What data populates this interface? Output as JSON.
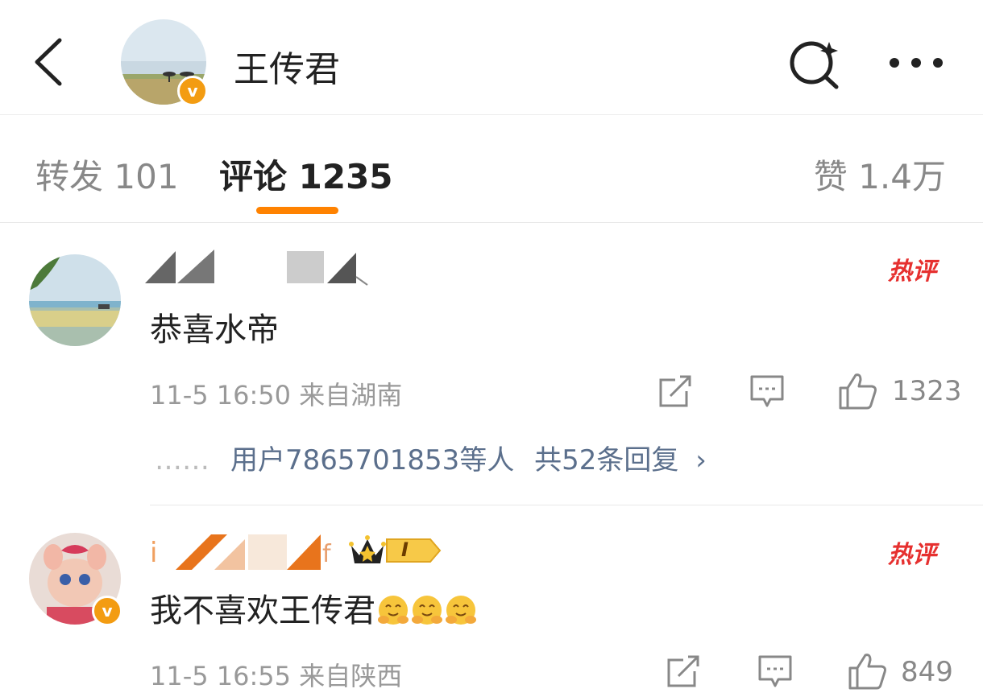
{
  "header": {
    "title": "王传君",
    "verified_badge": "v",
    "icons": [
      "back-arrow-icon",
      "search-icon",
      "more-icon"
    ]
  },
  "tabs": [
    {
      "label": "转发",
      "count": "101",
      "active": false
    },
    {
      "label": "评论",
      "count": "1235",
      "active": true
    },
    {
      "label": "赞",
      "count": "1.4万",
      "active": false
    }
  ],
  "accent_color": "#ff8200",
  "comments": [
    {
      "text": "恭喜水帝",
      "time": "11-5 16:50",
      "location": "来自湖南",
      "hot_label": "热评",
      "likes": "1323",
      "replies_dots": "……",
      "replies_users": "用户7865701853等人",
      "replies_count": "共52条回复",
      "replies_chevron": "›"
    },
    {
      "text": "我不喜欢王传君",
      "emojis": [
        "hug-emoji",
        "hug-emoji",
        "hug-emoji"
      ],
      "time": "11-5 16:55",
      "location": "来自陕西",
      "hot_label": "热评",
      "likes": "849",
      "verified_badge": "v",
      "level_badge": "I"
    }
  ]
}
